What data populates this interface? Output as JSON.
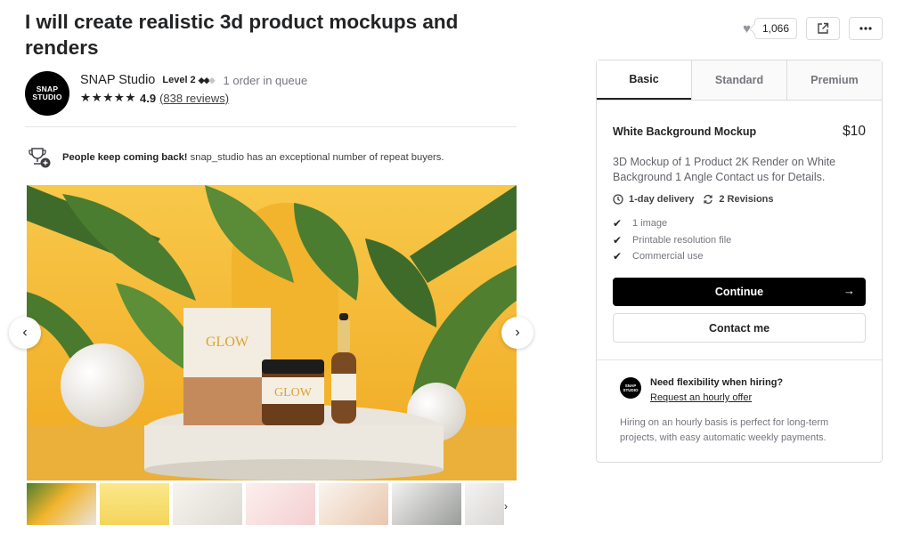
{
  "gig": {
    "title": "I will create realistic 3d product mockups and renders",
    "favorites_count": "1,066"
  },
  "seller": {
    "avatar_line1": "SNAP",
    "avatar_line2": "STUDIO",
    "name": "SNAP Studio",
    "level": "Level 2",
    "queue": "1 order in queue",
    "stars": "★★★★★",
    "rating": "4.9",
    "reviews": "(838 reviews)"
  },
  "repeat_buyers": {
    "headline": "People keep coming back!",
    "text": "snap_studio has an exceptional number of repeat buyers."
  },
  "gallery": {
    "thumbnail_count": 7
  },
  "package_tabs": [
    "Basic",
    "Standard",
    "Premium"
  ],
  "package": {
    "name": "White Background Mockup",
    "price": "$10",
    "description": "3D Mockup of 1 Product 2K Render on White Background 1 Angle Contact us for Details.",
    "delivery": "1-day delivery",
    "revisions": "2 Revisions",
    "features": [
      "1 image",
      "Printable resolution file",
      "Commercial use"
    ],
    "continue_label": "Continue",
    "contact_label": "Contact me"
  },
  "hourly": {
    "title": "Need flexibility when hiring?",
    "link": "Request an hourly offer",
    "description": "Hiring on an hourly basis is perfect for long-term projects, with easy automatic weekly payments."
  },
  "colors": {
    "primary_button": "#000000",
    "gallery_background": "#f4b731",
    "star": "#222325"
  },
  "icons": {
    "favorite": "heart-icon",
    "share": "share-icon",
    "more": "more-icon",
    "delivery": "clock-icon",
    "revisions": "refresh-icon",
    "feature": "check-icon",
    "continue": "arrow-right-icon",
    "repeat": "trophy-icon"
  }
}
